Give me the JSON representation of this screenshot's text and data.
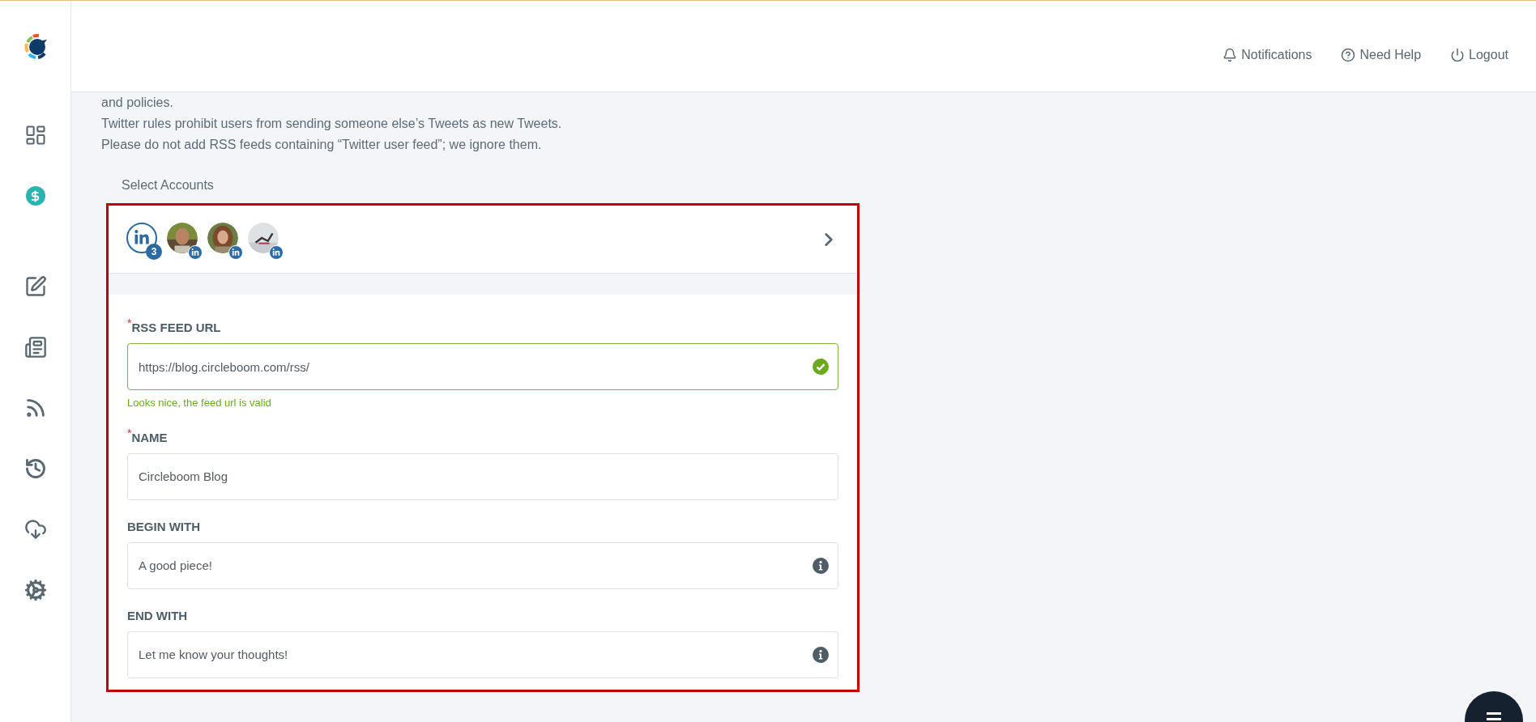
{
  "header": {
    "links": [
      {
        "kind": "notifications",
        "label": "Notifications"
      },
      {
        "kind": "help",
        "label": "Need Help"
      },
      {
        "kind": "logout",
        "label": "Logout"
      }
    ]
  },
  "intro_lines": [
    "and policies.",
    "Twitter rules prohibit users from sending someone else’s Tweets as new Tweets.",
    "Please do not add RSS feeds containing “Twitter user feed”; we ignore them."
  ],
  "select_accounts": {
    "title": "Select Accounts",
    "count": "3"
  },
  "fields": [
    {
      "label": "RSS FEED URL",
      "required_mark": "*",
      "value": "https://blog.circleboom.com/rss/",
      "kind": "valid",
      "message": "Looks nice, the feed url is valid"
    },
    {
      "label": "NAME",
      "required_mark": "*",
      "value": "Circleboom Blog",
      "kind": "plain"
    },
    {
      "label": "BEGIN WITH",
      "value": "A good piece!",
      "kind": "info"
    },
    {
      "label": "END WITH",
      "value": "Let me know your thoughts!",
      "kind": "info"
    }
  ]
}
